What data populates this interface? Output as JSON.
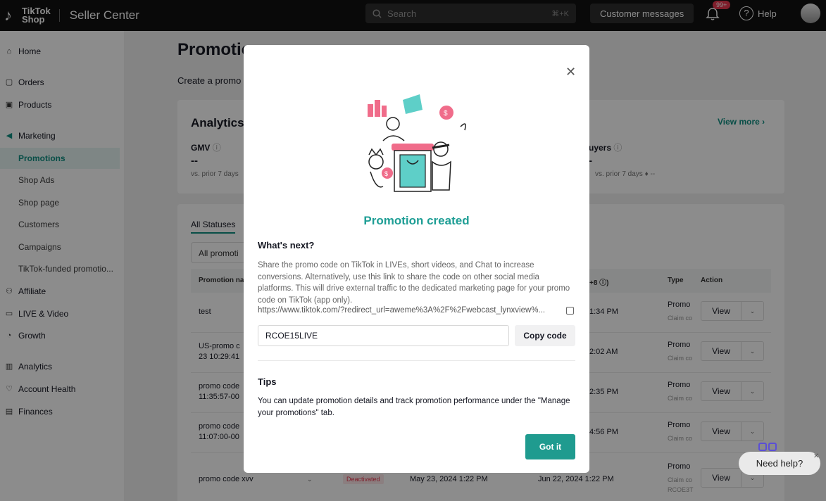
{
  "topbar": {
    "brand_line1": "TikTok",
    "brand_line2": "Shop",
    "product": "Seller Center",
    "search_placeholder": "Search",
    "search_shortcut": "⌘+K",
    "customer_messages": "Customer messages",
    "notification_count": "99+",
    "help": "Help"
  },
  "sidebar": {
    "items": [
      {
        "label": "Home",
        "icon": "home-icon"
      },
      {
        "label": "Orders",
        "icon": "clipboard-icon"
      },
      {
        "label": "Products",
        "icon": "box-icon"
      },
      {
        "label": "Marketing",
        "icon": "megaphone-icon"
      },
      {
        "label": "Promotions"
      },
      {
        "label": "Shop Ads"
      },
      {
        "label": "Shop page"
      },
      {
        "label": "Customers"
      },
      {
        "label": "Campaigns"
      },
      {
        "label": "TikTok-funded promotio..."
      },
      {
        "label": "Affiliate",
        "icon": "people-icon"
      },
      {
        "label": "LIVE & Video",
        "icon": "video-icon"
      },
      {
        "label": "Growth",
        "icon": "growth-icon"
      },
      {
        "label": "Analytics",
        "icon": "analytics-icon"
      },
      {
        "label": "Account Health",
        "icon": "health-icon"
      },
      {
        "label": "Finances",
        "icon": "wallet-icon"
      }
    ]
  },
  "main": {
    "title": "Promotio",
    "subtitle": "Create a promo",
    "analytics": {
      "title": "Analytics",
      "view_more": "View more",
      "gmv_label": "GMV",
      "gmv_value": "--",
      "gmv_compare": "vs. prior 7 days",
      "buyers_label": "uyers",
      "buyers_value": "-",
      "buyers_compare": "vs. prior 7 days",
      "buyers_delta": "--"
    },
    "tabs": {
      "all_statuses": "All Statuses"
    },
    "filter_value": "All promoti",
    "table": {
      "headers": {
        "name": "Promotion na",
        "time": "+8",
        "type": "Type",
        "action": "Action"
      },
      "rows": [
        {
          "name": "test",
          "time": "1:34 PM",
          "type": "Promo",
          "type_sub": "Claim co",
          "action": "View"
        },
        {
          "name": "US-promo c\n23 10:29:41",
          "time": "2:02 AM",
          "type": "Promo",
          "type_sub": "Claim co",
          "action": "View"
        },
        {
          "name": "promo code\n11:35:57-00",
          "time": "2:35 PM",
          "type": "Promo",
          "type_sub": "Claim co",
          "action": "View"
        },
        {
          "name": "promo code\n11:07:00-00",
          "time": "4:56 PM",
          "type": "Promo",
          "type_sub": "Claim co",
          "action": "View"
        },
        {
          "name": "promo code xvv",
          "status": "Deactivated",
          "start": "May 23, 2024 1:22 PM",
          "time": "Jun 22, 2024 1:22 PM",
          "type": "Promo",
          "type_sub": "Claim co",
          "type_sub2": "RCOE3T",
          "action": "View"
        }
      ]
    }
  },
  "modal": {
    "title": "Promotion created",
    "whats_next": "What's next?",
    "description": "Share the promo code on TikTok in LIVEs, short videos, and Chat to increase conversions. Alternatively, use this link to share the code on other social media platforms. This will drive external traffic to the dedicated marketing page for your promo code on TikTok (app only).",
    "link": "https://www.tiktok.com/?redirect_url=aweme%3A%2F%2Fwebcast_lynxview%...",
    "promo_code": "RCOE15LIVE",
    "copy_code": "Copy code",
    "tips_title": "Tips",
    "tips_text": "You can update promotion details and track promotion performance under the \"Manage your promotions\" tab.",
    "got_it": "Got it"
  },
  "need_help": "Need help?",
  "colors": {
    "accent": "#1f9b8f",
    "topbar": "#121212",
    "badge": "#e8384f"
  }
}
